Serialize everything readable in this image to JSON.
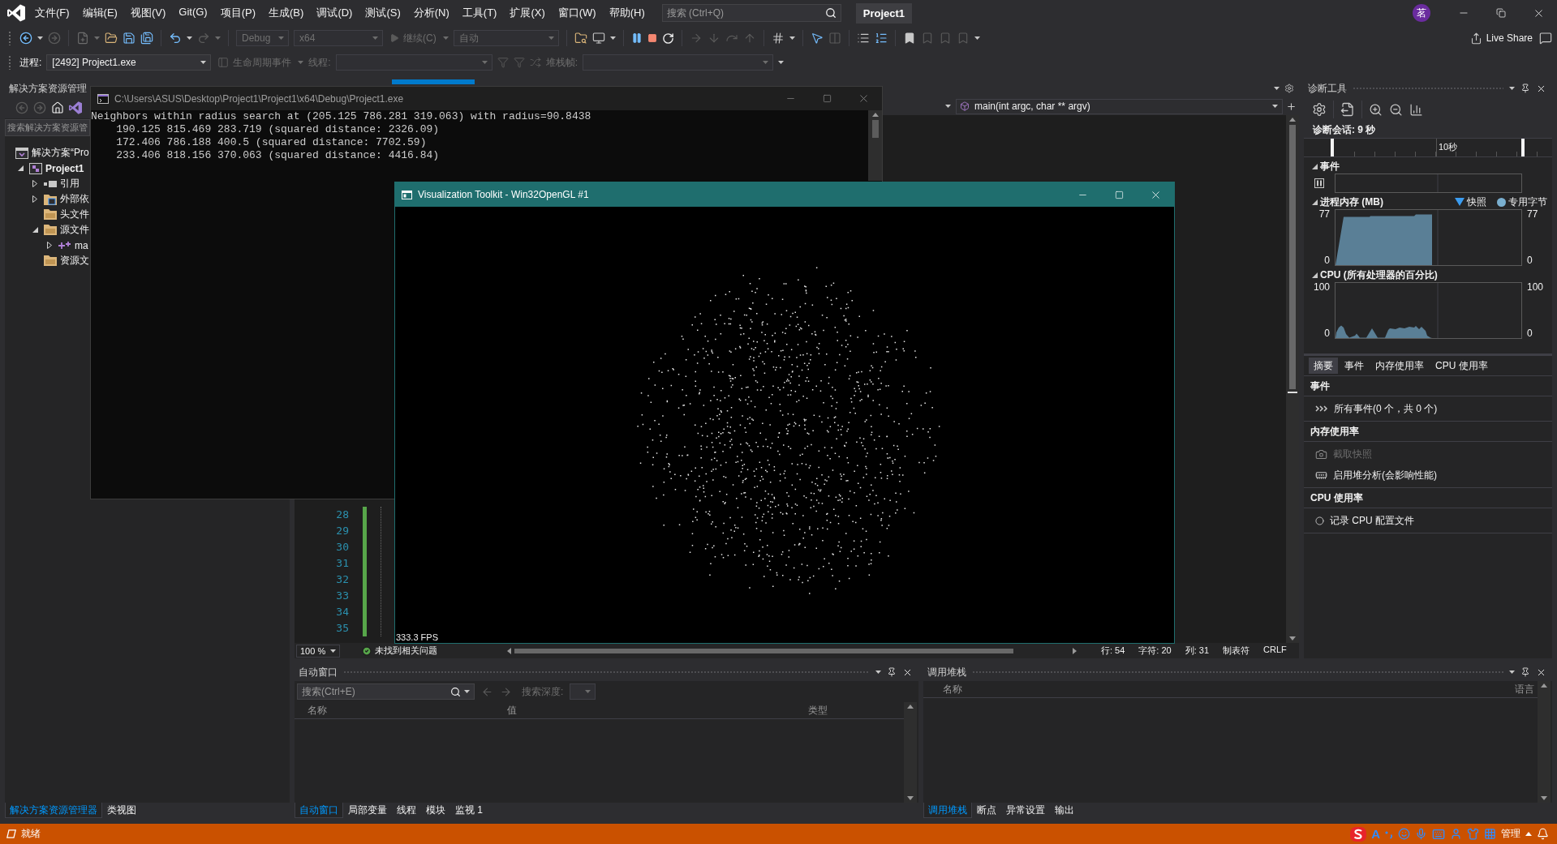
{
  "title_bar": {
    "menu": [
      "文件(F)",
      "编辑(E)",
      "视图(V)",
      "Git(G)",
      "项目(P)",
      "生成(B)",
      "调试(D)",
      "测试(S)",
      "分析(N)",
      "工具(T)",
      "扩展(X)",
      "窗口(W)",
      "帮助(H)"
    ],
    "search": {
      "placeholder": "搜索 (Ctrl+Q)"
    },
    "solution": "Project1",
    "account": "茗"
  },
  "standard_toolbar": {
    "configuration": {
      "value": "Debug",
      "disabled": true
    },
    "platform": {
      "value": "x64",
      "disabled": true
    },
    "continue": {
      "label": "继续(C)",
      "disabled": true
    },
    "target": {
      "value": "自动",
      "disabled": true
    },
    "live_share": "Live Share"
  },
  "debug_location_toolbar": {
    "process_label": "进程:",
    "process": "[2492] Project1.exe",
    "lifecycle": {
      "label": "生命周期事件",
      "disabled": true
    },
    "thread": {
      "label": "线程:",
      "disabled": true
    },
    "stack_frame": {
      "label": "堆栈帧:",
      "disabled": true
    }
  },
  "solution_explorer": {
    "title": "解决方案资源管理",
    "search": {
      "placeholder": "搜索解决方案资源管"
    },
    "tree": [
      {
        "label": "解决方案“Pro",
        "kind": "solution",
        "children": [
          {
            "label": "Project1",
            "kind": "project",
            "expanded": true,
            "children": [
              {
                "label": "引用",
                "kind": "references",
                "expanded": false
              },
              {
                "label": "外部依",
                "kind": "external",
                "expanded": false
              },
              {
                "label": "头文件",
                "kind": "filter"
              },
              {
                "label": "源文件",
                "kind": "filter",
                "expanded": true,
                "children": [
                  {
                    "label": "ma",
                    "kind": "cpp",
                    "expanded": false
                  }
                ]
              },
              {
                "label": "资源文",
                "kind": "filter"
              }
            ]
          }
        ]
      }
    ],
    "tabs": [
      {
        "label": "解决方案资源管理器",
        "selected": true
      },
      {
        "label": "类视图",
        "selected": false
      }
    ]
  },
  "editor": {
    "function": "main(int argc, char ** argv)",
    "line_numbers": [
      "28",
      "29",
      "30",
      "31",
      "32",
      "33",
      "34",
      "35"
    ],
    "zoom": "100 %",
    "issues": "未找到相关问题",
    "status": [
      "行: 54",
      "字符: 20",
      "列: 31",
      "制表符",
      "CRLF"
    ]
  },
  "diagnostic_tools": {
    "title": "诊断工具",
    "session": "诊断会话: 9 秒",
    "timeline_label": "10秒",
    "events_graph": {
      "title": "事件"
    },
    "memory_graph": {
      "title": "进程内存 (MB)",
      "legend": [
        {
          "label": "快照",
          "kind": "triangle",
          "color": "#3b9cf0"
        },
        {
          "label": "专用字节",
          "kind": "circle",
          "color": "#7aafcf"
        }
      ],
      "left_axis": [
        "77",
        "0"
      ],
      "right_axis": [
        "77",
        "0"
      ]
    },
    "cpu_graph": {
      "title": "CPU (所有处理器的百分比)",
      "left_axis": [
        "100",
        "0"
      ],
      "right_axis": [
        "100",
        "0"
      ]
    },
    "tabs": [
      {
        "label": "摘要",
        "selected": true
      },
      {
        "label": "事件",
        "selected": false
      },
      {
        "label": "内存使用率",
        "selected": false
      },
      {
        "label": "CPU 使用率",
        "selected": false
      }
    ],
    "sections": [
      {
        "heading": "事件",
        "items": [
          {
            "label": "所有事件(0 个，共 0 个)",
            "kind": "events",
            "disabled": false
          }
        ]
      },
      {
        "heading": "内存使用率",
        "items": [
          {
            "label": "截取快照",
            "kind": "snapshot",
            "disabled": true
          },
          {
            "label": "启用堆分析(会影响性能)",
            "kind": "heap",
            "disabled": false
          }
        ]
      },
      {
        "heading": "CPU 使用率",
        "items": [
          {
            "label": "记录 CPU 配置文件",
            "kind": "record",
            "disabled": false
          }
        ]
      }
    ]
  },
  "autos": {
    "title": "自动窗口",
    "search": {
      "placeholder": "搜索(Ctrl+E)"
    },
    "depth_label": "搜索深度:",
    "columns": [
      "名称",
      "值",
      "类型"
    ],
    "tabs": [
      {
        "label": "自动窗口",
        "selected": true
      },
      {
        "label": "局部变量",
        "selected": false
      },
      {
        "label": "线程",
        "selected": false
      },
      {
        "label": "模块",
        "selected": false
      },
      {
        "label": "监视 1",
        "selected": false
      }
    ]
  },
  "call_stack": {
    "title": "调用堆栈",
    "columns": [
      "名称",
      "语言"
    ],
    "tabs": [
      {
        "label": "调用堆栈",
        "selected": true
      },
      {
        "label": "断点",
        "selected": false
      },
      {
        "label": "异常设置",
        "selected": false
      },
      {
        "label": "输出",
        "selected": false
      }
    ]
  },
  "status_bar": {
    "text": "就绪",
    "ime": {
      "mode": "A",
      "label": "管理"
    }
  },
  "console_window": {
    "title": "C:\\Users\\ASUS\\Desktop\\Project1\\Project1\\x64\\Debug\\Project1.exe",
    "lines": [
      "Neighbors within radius search at (205.125 786.281 319.063) with radius=90.8438",
      "    190.125 815.469 283.719 (squared distance: 2326.09)",
      "    172.406 786.188 400.5 (squared distance: 7702.59)",
      "    233.406 818.156 370.063 (squared distance: 4416.84)"
    ]
  },
  "vtk_window": {
    "title": "Visualization Toolkit - Win32OpenGL #1",
    "fps": "333.3 FPS"
  }
}
